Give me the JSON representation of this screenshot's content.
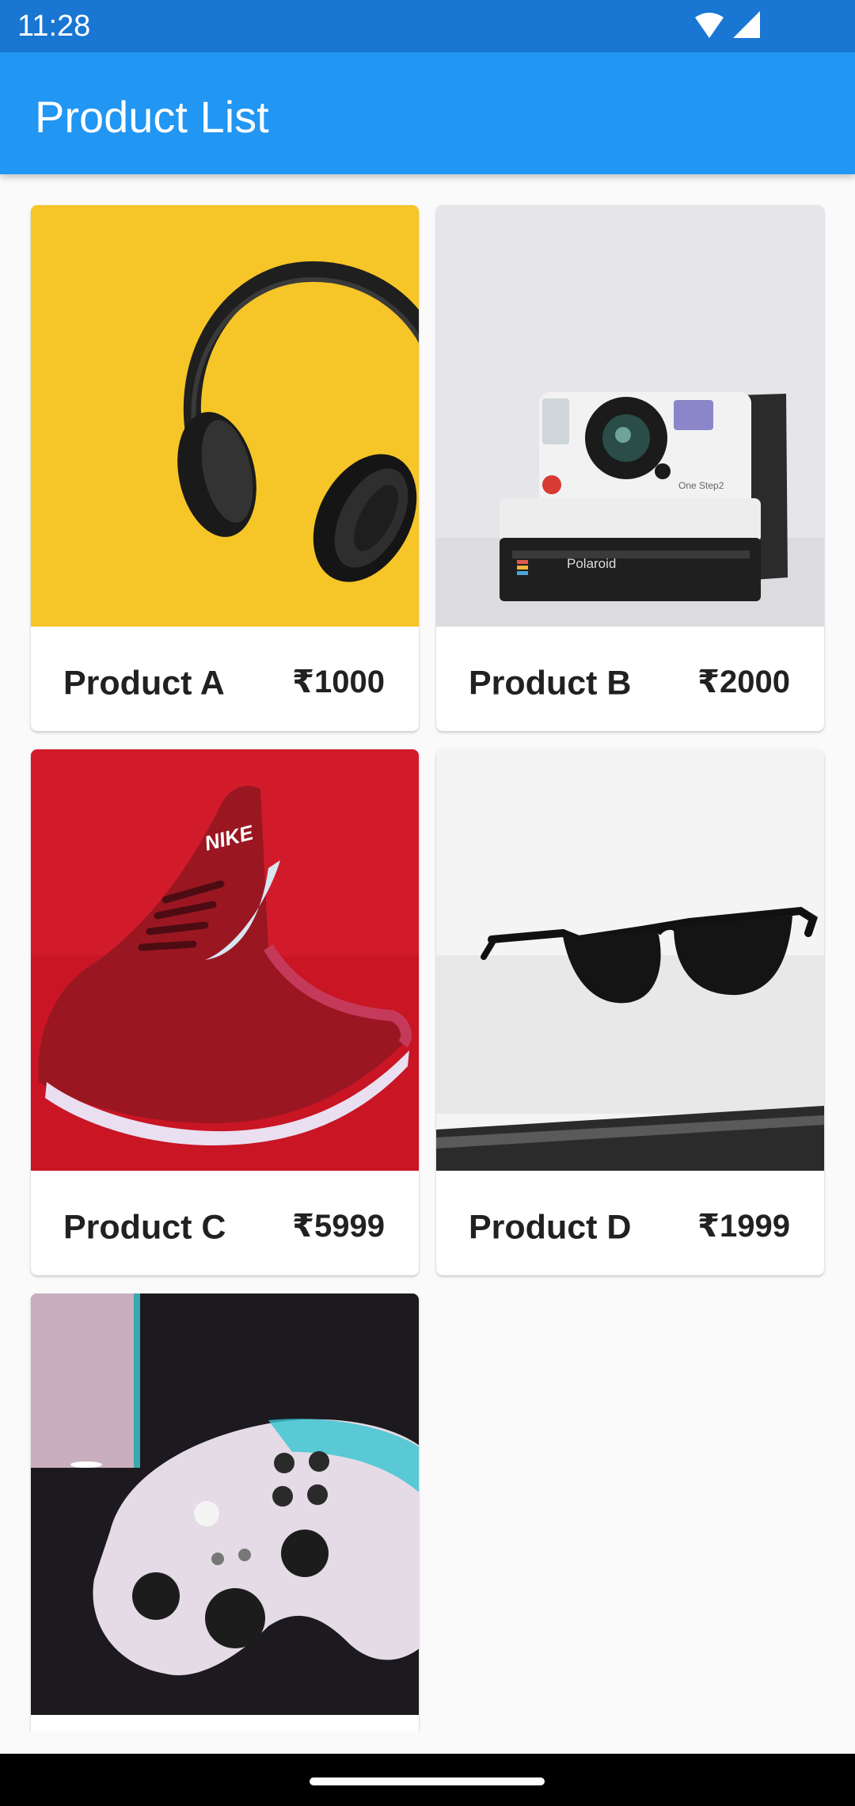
{
  "status_bar": {
    "time": "11:28",
    "icons": [
      "wifi-icon",
      "cell-signal-icon"
    ],
    "background": "#1976d2"
  },
  "app_bar": {
    "title": "Product List",
    "background": "#2196f3"
  },
  "products": [
    {
      "name": "Product A",
      "price": "₹1000",
      "image": "headphones-image"
    },
    {
      "name": "Product B",
      "price": "₹2000",
      "image": "polaroid-camera-image"
    },
    {
      "name": "Product C",
      "price": "₹5999",
      "image": "running-shoe-image"
    },
    {
      "name": "Product D",
      "price": "₹1999",
      "image": "sunglasses-image"
    },
    {
      "name": "",
      "price": "",
      "image": "game-controller-image"
    }
  ],
  "image_text": {
    "camera_brand": "Polaroid",
    "camera_model": "One Step2",
    "shoe_brand": "NIKE"
  },
  "colors": {
    "page_background": "#fafafa",
    "card_background": "#ffffff",
    "text": "#212121"
  }
}
